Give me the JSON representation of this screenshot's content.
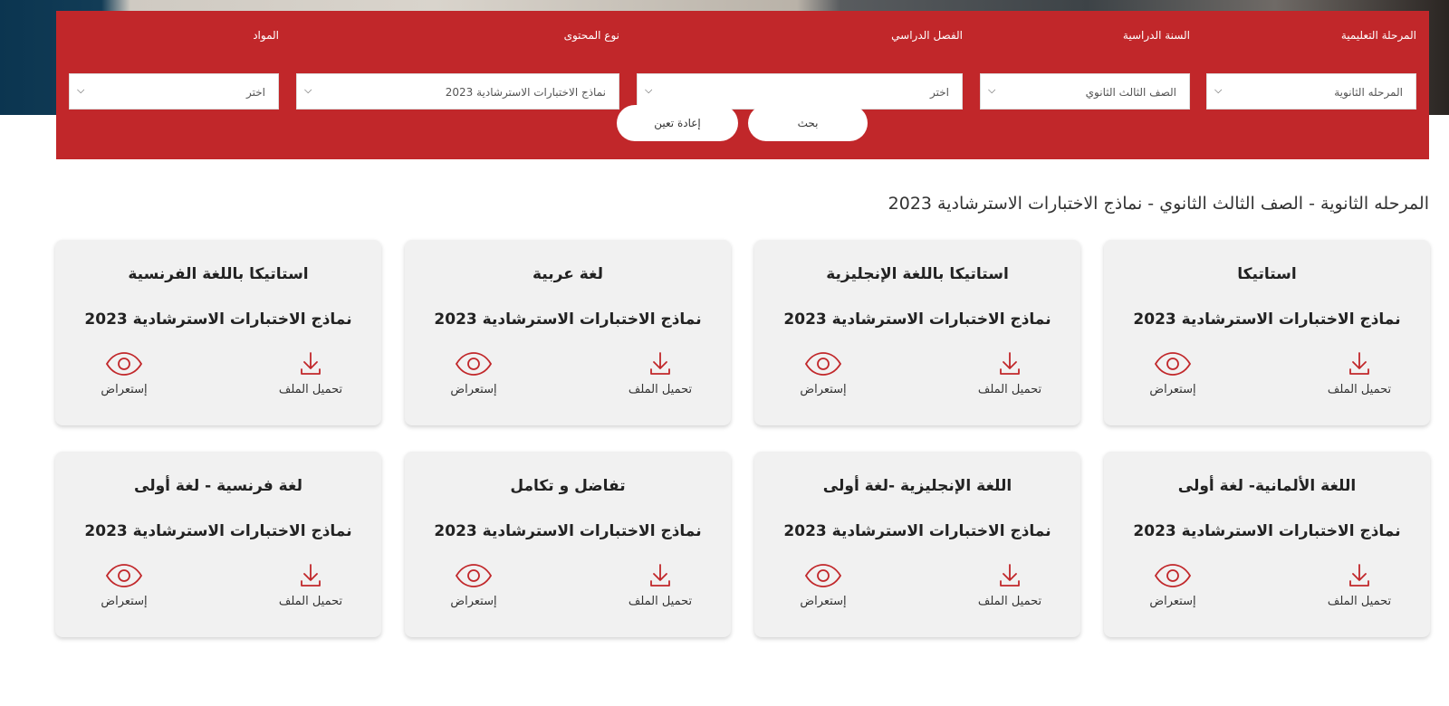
{
  "colors": {
    "brand": "#c1272a",
    "card_bg": "#f1f1f1",
    "icon": "#c1272a"
  },
  "filters": {
    "fields": [
      {
        "label": "المرحلة التعليمية",
        "value": "المرحله الثانوية"
      },
      {
        "label": "السنة الدراسية",
        "value": "الصف الثالث الثانوي"
      },
      {
        "label": "الفصل الدراسي",
        "value": "اختر"
      },
      {
        "label": "نوع المحتوى",
        "value": "نماذج الاختبارات الاسترشادية 2023"
      },
      {
        "label": "المواد",
        "value": "اختر"
      }
    ],
    "search_label": "بحث",
    "reset_label": "إعادة تعين"
  },
  "breadcrumb": "المرحله الثانوية - الصف الثالث الثانوي - نماذج الاختبارات الاسترشادية 2023",
  "cards": [
    {
      "title": "استاتيكا",
      "subtitle": "نماذج الاختبارات الاسترشادية 2023",
      "download_label": "تحميل الملف",
      "view_label": "إستعراض"
    },
    {
      "title": "استاتيكا باللغة الإنجليزية",
      "subtitle": "نماذج الاختبارات الاسترشادية 2023",
      "download_label": "تحميل الملف",
      "view_label": "إستعراض"
    },
    {
      "title": "لغة عربية",
      "subtitle": "نماذج الاختبارات الاسترشادية 2023",
      "download_label": "تحميل الملف",
      "view_label": "إستعراض"
    },
    {
      "title": "استاتيكا باللغة الفرنسية",
      "subtitle": "نماذج الاختبارات الاسترشادية 2023",
      "download_label": "تحميل الملف",
      "view_label": "إستعراض"
    },
    {
      "title": "اللغة الألمانية- لغة أولى",
      "subtitle": "نماذج الاختبارات الاسترشادية 2023",
      "download_label": "تحميل الملف",
      "view_label": "إستعراض"
    },
    {
      "title": "اللغة الإنجليزية -لغة أولى",
      "subtitle": "نماذج الاختبارات الاسترشادية 2023",
      "download_label": "تحميل الملف",
      "view_label": "إستعراض"
    },
    {
      "title": "تفاضل و تكامل",
      "subtitle": "نماذج الاختبارات الاسترشادية 2023",
      "download_label": "تحميل الملف",
      "view_label": "إستعراض"
    },
    {
      "title": "لغة فرنسية - لغة أولى",
      "subtitle": "نماذج الاختبارات الاسترشادية 2023",
      "download_label": "تحميل الملف",
      "view_label": "إستعراض"
    }
  ]
}
